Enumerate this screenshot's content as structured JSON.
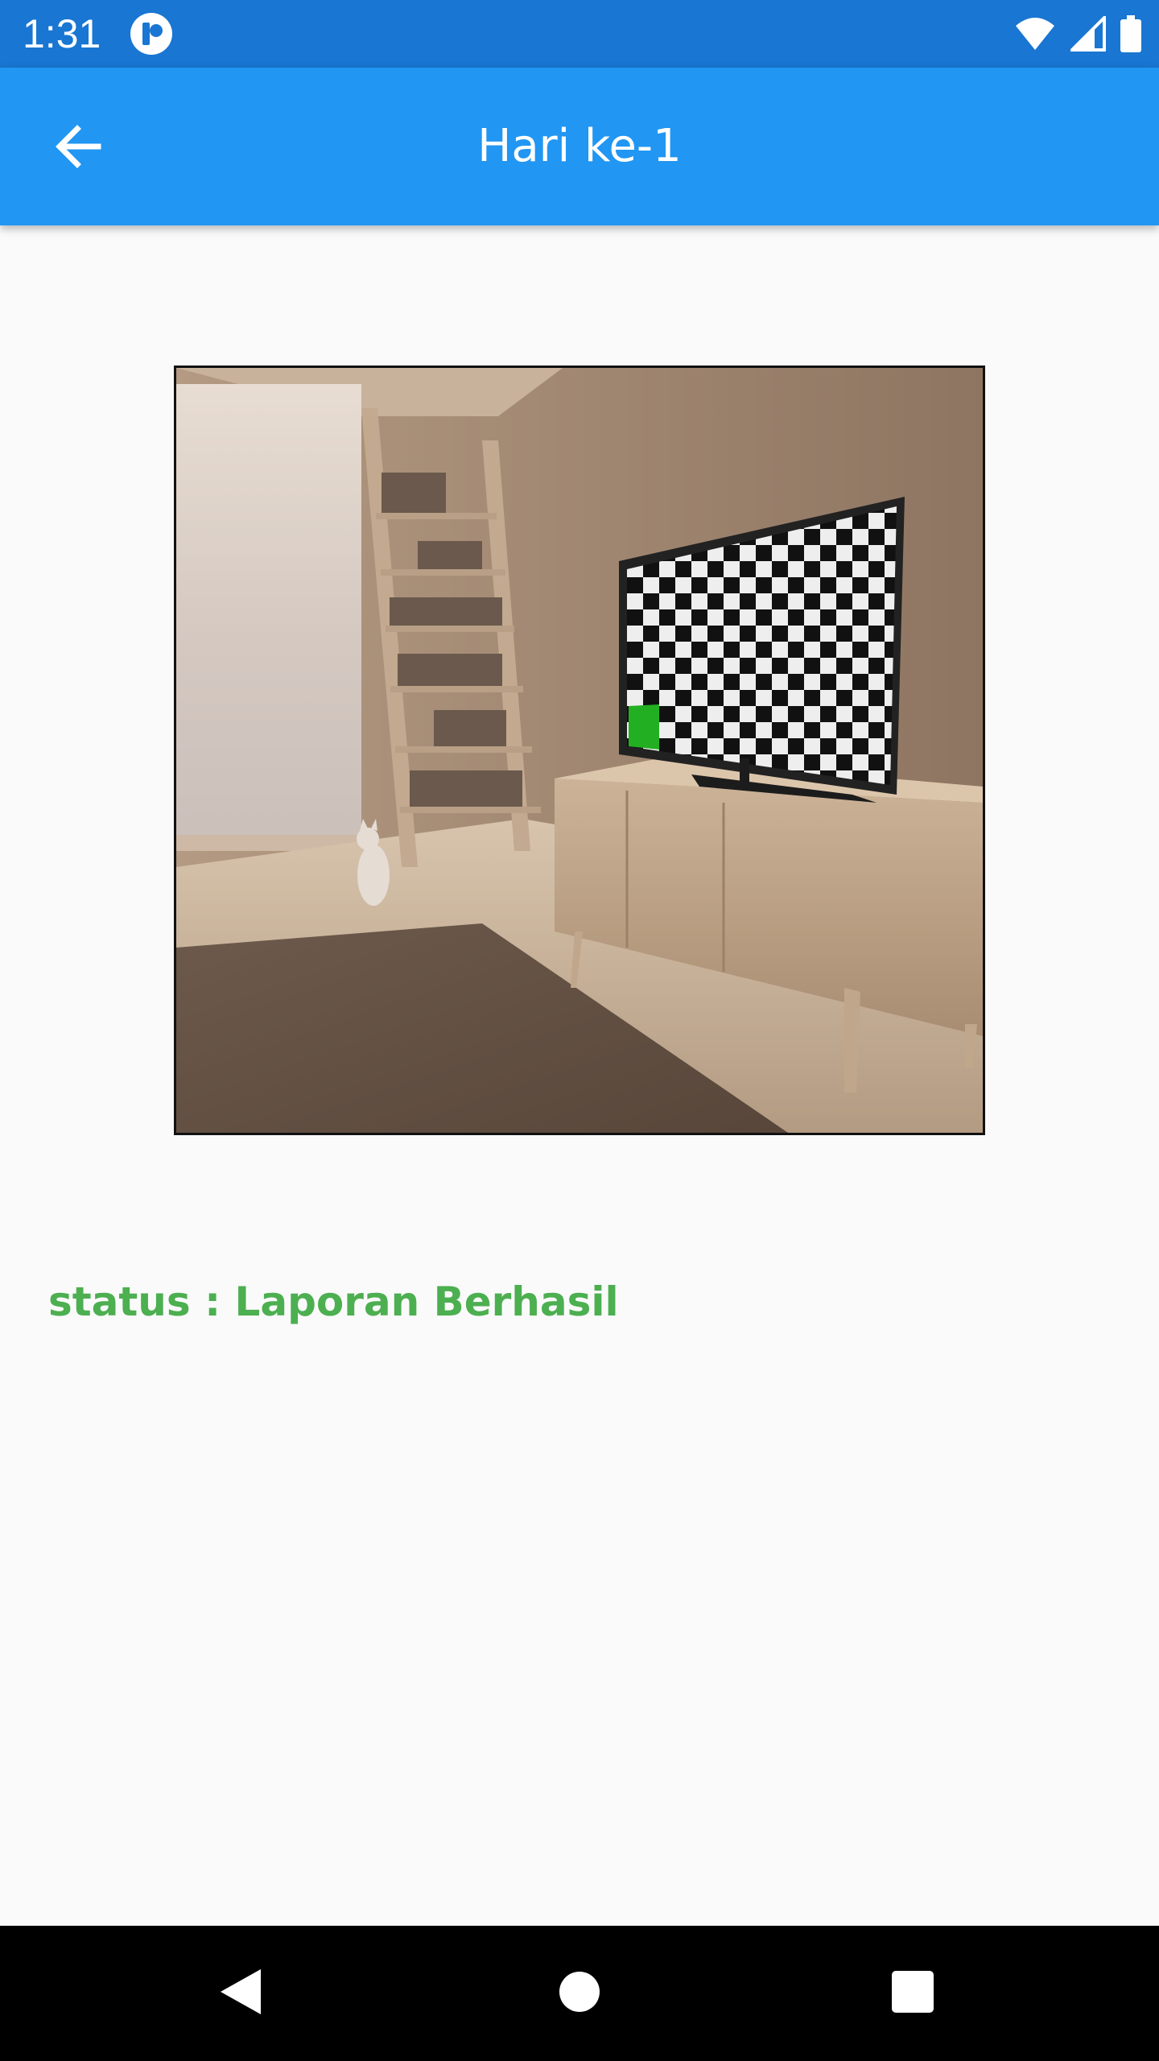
{
  "status_bar": {
    "time": "1:31",
    "background": "#1976d2"
  },
  "app_bar": {
    "title": "Hari ke-1",
    "back_icon": "arrow-back-icon",
    "background": "#2196f3"
  },
  "photo": {
    "description_icon": "room-with-tv-checkerboard-photo"
  },
  "status": {
    "text": "status : Laporan Berhasil",
    "color": "#4caf50"
  },
  "nav_bar": {
    "back_icon": "triangle-back-icon",
    "home_icon": "circle-home-icon",
    "recent_icon": "square-recents-icon"
  }
}
